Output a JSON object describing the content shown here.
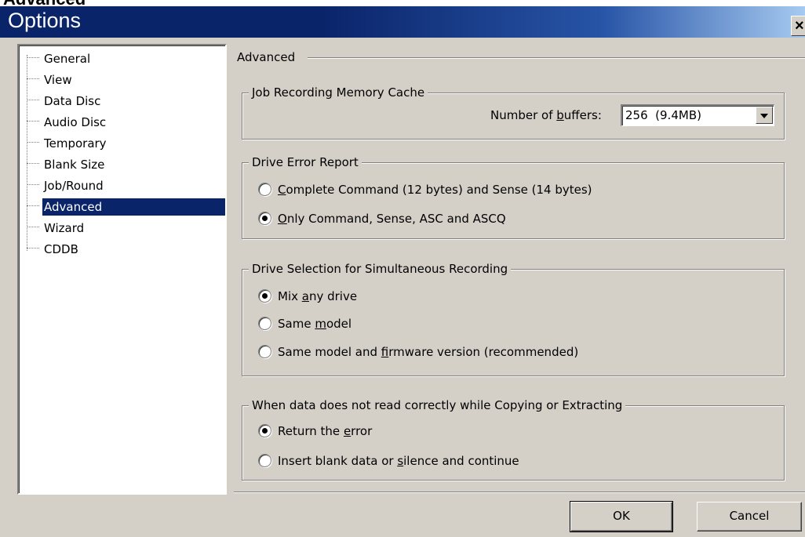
{
  "behind_window_title": "Advanced",
  "window": {
    "title": "Options",
    "close_glyph": "×"
  },
  "tree": {
    "items": [
      {
        "label": "General"
      },
      {
        "label": "View"
      },
      {
        "label": "Data Disc"
      },
      {
        "label": "Audio Disc"
      },
      {
        "label": "Temporary"
      },
      {
        "label": "Blank Size"
      },
      {
        "label": "Job/Round"
      },
      {
        "label": "Advanced",
        "selected": true
      },
      {
        "label": "Wizard"
      },
      {
        "label": "CDDB"
      }
    ]
  },
  "page": {
    "section_title": "Advanced",
    "cache_group": {
      "title": "Job Recording Memory Cache",
      "buffers_label_pre": "Number of ",
      "buffers_label_ul": "b",
      "buffers_label_post": "uffers:",
      "buffers_value": "256  (9.4MB)"
    },
    "error_group": {
      "title": "Drive Error Report",
      "options": [
        {
          "ul": "C",
          "rest": "omplete Command (12 bytes) and Sense (14 bytes)",
          "checked": false
        },
        {
          "ul": "O",
          "rest": "nly Command, Sense, ASC and ASCQ",
          "checked": true
        }
      ]
    },
    "drive_group": {
      "title": "Drive Selection for Simultaneous Recording",
      "options": [
        {
          "pre": "Mix ",
          "ul": "a",
          "post": "ny drive",
          "checked": true
        },
        {
          "pre": "Same ",
          "ul": "m",
          "post": "odel",
          "checked": false
        },
        {
          "pre": "Same model and ",
          "ul": "f",
          "post": "irmware version (recommended)",
          "checked": false
        }
      ]
    },
    "read_group": {
      "title": "When data does not read correctly while Copying or Extracting",
      "options": [
        {
          "pre": "Return the ",
          "ul": "e",
          "post": "rror",
          "checked": true
        },
        {
          "pre": "Insert blank data or ",
          "ul": "s",
          "post": "ilence and continue",
          "checked": false
        }
      ]
    }
  },
  "buttons": {
    "ok": "OK",
    "cancel": "Cancel"
  }
}
